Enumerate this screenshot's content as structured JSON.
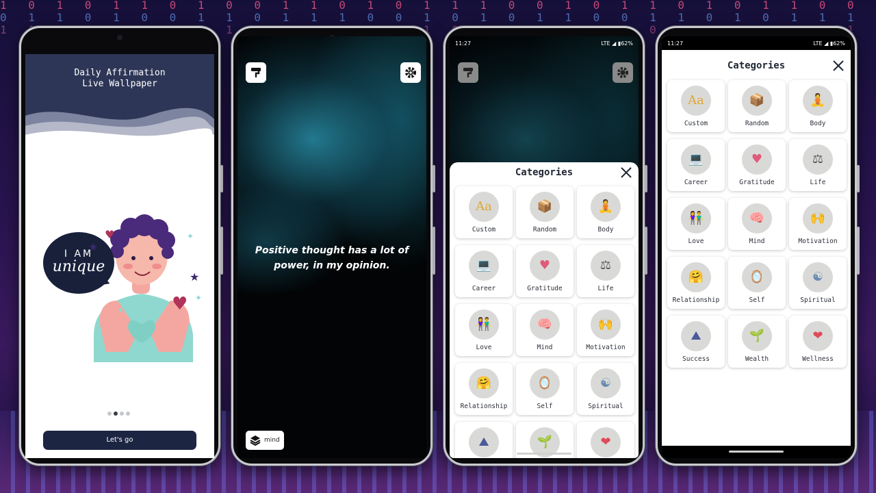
{
  "colors": {
    "accent_dark": "#1c2541",
    "header_blue": "#2d3656",
    "card_bg": "#ffffff",
    "circle_bg": "#d9dad7"
  },
  "onboarding": {
    "title_line1": "Daily Affirmation",
    "title_line2": "Live Wallpaper",
    "bubble_line1": "I AM",
    "bubble_line2": "unique",
    "button_label": "Let's go",
    "page_count": 4,
    "current_page": 2
  },
  "wallpaper": {
    "quote": "Positive thought has a lot of power, in my opinion.",
    "category_chip": "mind",
    "top_left_icon": "paint-roller-icon",
    "top_right_icon": "gear-icon",
    "chip_icon": "layers-icon"
  },
  "status_bar": {
    "time": "11:27",
    "network": "LTE",
    "battery": "62%"
  },
  "categories": {
    "title": "Categories",
    "close_icon": "close-icon",
    "items": [
      {
        "label": "Custom",
        "icon": "Aa"
      },
      {
        "label": "Random",
        "icon": "box-icon"
      },
      {
        "label": "Body",
        "icon": "yoga-icon"
      },
      {
        "label": "Career",
        "icon": "desk-icon"
      },
      {
        "label": "Gratitude",
        "icon": "heart-hand-icon"
      },
      {
        "label": "Life",
        "icon": "balance-icon"
      },
      {
        "label": "Love",
        "icon": "couple-icon"
      },
      {
        "label": "Mind",
        "icon": "brain-icon"
      },
      {
        "label": "Motivation",
        "icon": "cheer-icon"
      },
      {
        "label": "Relationship",
        "icon": "hug-icon"
      },
      {
        "label": "Self",
        "icon": "mirror-icon"
      },
      {
        "label": "Spiritual",
        "icon": "aura-icon"
      },
      {
        "label": "Success",
        "icon": "climb-icon"
      },
      {
        "label": "Wealth",
        "icon": "plant-icon"
      },
      {
        "label": "Wellness",
        "icon": "heart-hands-icon"
      }
    ]
  },
  "background_binary": {
    "row1": "1 0 1 0 1 1 0 1 0 0 1 1 0 1 0 1 1 1 0 0 1 0 1 1 0 1 0 1 1 0 0 1 0 1 0 1 1 0 1 0 0 1 1 0 1 0 1 0 1 1",
    "row2": "0 1 1 0 1 0 0 1 1 0 1 1 1 0 0 1 0 1 0 1 1 0 0 1 1 0 1 0 1 1 1 0 1 0 0 1 0 1 1 0 1 0 0 1 0 1 1 0 1 0",
    "row3": "1 1 0 1 0 0 1 0 1 1 0 0 1 0 1 1 0 1 1 0 0 1 0 0 1 1 0 1 0 0 1 1 0 0 1 0 1 0 1 1 0 1 0 0 1 1 0 1 1 0"
  }
}
